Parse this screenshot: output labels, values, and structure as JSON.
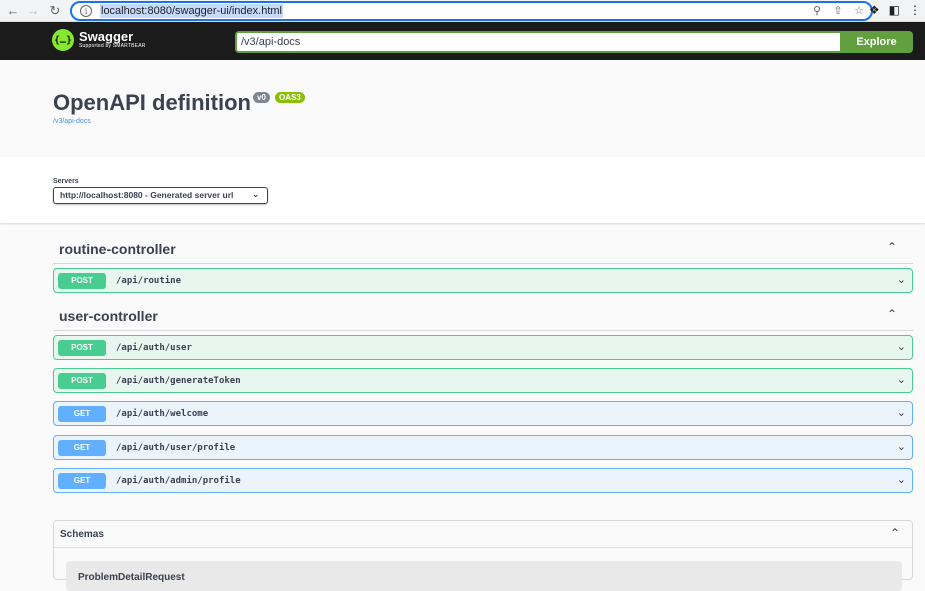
{
  "browser": {
    "url": "localhost:8080/swagger-ui/index.html"
  },
  "topbar": {
    "logo_title": "Swagger",
    "logo_subtitle": "Supported by SMARTBEAR",
    "spec_url": "/v3/api-docs",
    "explore_label": "Explore"
  },
  "info": {
    "title": "OpenAPI definition",
    "version_badge": "v0",
    "oas_badge": "OAS3",
    "spec_link": "/v3/api-docs"
  },
  "servers": {
    "label": "Servers",
    "selected": "http://localhost:8080 - Generated server url"
  },
  "tags": [
    {
      "name": "routine-controller",
      "operations": [
        {
          "method": "POST",
          "path": "/api/routine"
        }
      ]
    },
    {
      "name": "user-controller",
      "operations": [
        {
          "method": "POST",
          "path": "/api/auth/user"
        },
        {
          "method": "POST",
          "path": "/api/auth/generateToken"
        },
        {
          "method": "GET",
          "path": "/api/auth/welcome"
        },
        {
          "method": "GET",
          "path": "/api/auth/user/profile"
        },
        {
          "method": "GET",
          "path": "/api/auth/admin/profile"
        }
      ]
    }
  ],
  "schemas": {
    "title": "Schemas",
    "first_item": "ProblemDetailRequest"
  },
  "colors": {
    "post": "#49cc90",
    "get": "#61affe",
    "explore": "#62a03f",
    "topbar": "#1b1b1b"
  }
}
